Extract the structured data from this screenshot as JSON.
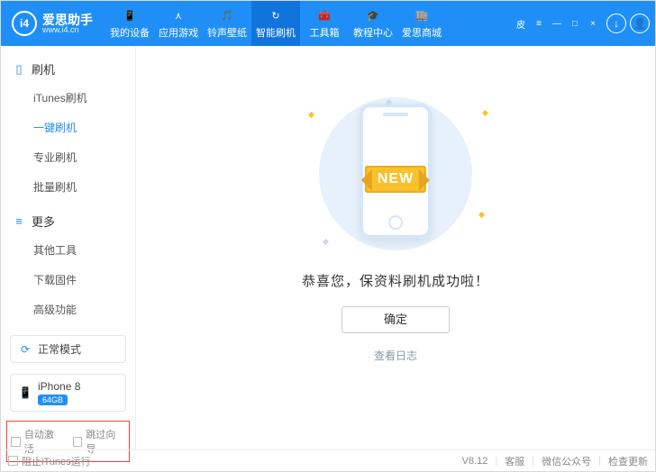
{
  "brand": {
    "name": "爱思助手",
    "url": "www.i4.cn",
    "logo_text": "i4"
  },
  "window_controls": {
    "skin": "皮",
    "menu": "≡",
    "min": "—",
    "max": "□",
    "close": "×"
  },
  "nav": [
    {
      "label": "我的设备",
      "icon": "📱"
    },
    {
      "label": "应用游戏",
      "icon": "⋏"
    },
    {
      "label": "铃声壁纸",
      "icon": "🎵"
    },
    {
      "label": "智能刷机",
      "icon": "↻",
      "active": true
    },
    {
      "label": "工具箱",
      "icon": "🧰"
    },
    {
      "label": "教程中心",
      "icon": "🎓"
    },
    {
      "label": "爱思商城",
      "icon": "🏬"
    }
  ],
  "header_actions": {
    "download": "↓",
    "user": "👤"
  },
  "sidebar": {
    "sections": [
      {
        "title": "刷机",
        "items": [
          "iTunes刷机",
          "一键刷机",
          "专业刷机",
          "批量刷机"
        ],
        "active_index": 1
      },
      {
        "title": "更多",
        "items": [
          "其他工具",
          "下载固件",
          "高级功能"
        ],
        "active_index": -1
      }
    ],
    "mode": {
      "label": "正常模式"
    },
    "device": {
      "name": "iPhone 8",
      "storage": "64GB"
    },
    "options": {
      "auto_activate": "自动激活",
      "skip_guide": "跳过向导"
    }
  },
  "main": {
    "ribbon": "NEW",
    "success_msg": "恭喜您，保资料刷机成功啦！",
    "ok_btn": "确定",
    "log_link": "查看日志"
  },
  "footer": {
    "block_itunes": "阻止iTunes运行",
    "version": "V8.12",
    "links": [
      "客服",
      "微信公众号",
      "检查更新"
    ]
  }
}
